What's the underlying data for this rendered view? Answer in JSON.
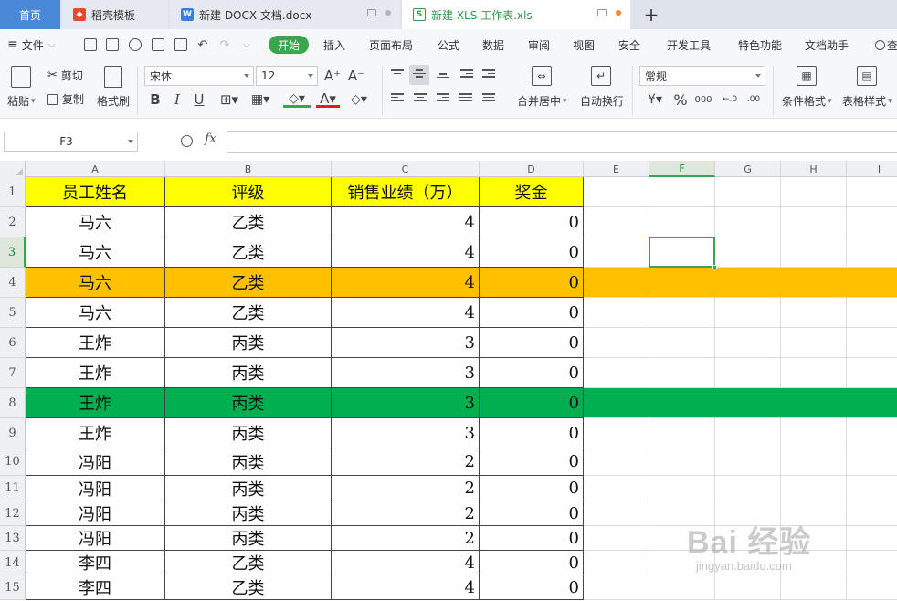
{
  "tabs": {
    "home": "首页",
    "templates": "稻壳模板",
    "docx": "新建 DOCX 文档.docx",
    "xls": "新建 XLS 工作表.xls",
    "add": "+"
  },
  "menu": {
    "file": "文件",
    "start": "开始",
    "items": [
      "插入",
      "页面布局",
      "公式",
      "数据",
      "审阅",
      "视图",
      "安全",
      "开发工具",
      "特色功能",
      "文档助手",
      "查"
    ]
  },
  "ribbon": {
    "paste": "粘贴",
    "cut": "剪切",
    "copy": "复制",
    "format_painter": "格式刷",
    "font_name": "宋体",
    "font_size": "12",
    "merge_center": "合并居中",
    "wrap_text": "自动换行",
    "number_format": "常规",
    "conditional_format": "条件格式",
    "table_style": "表格样式"
  },
  "formula_bar": {
    "name_box": "F3",
    "fx": "fx",
    "formula": ""
  },
  "columns": [
    "A",
    "B",
    "C",
    "D",
    "E",
    "F",
    "G",
    "H",
    "I"
  ],
  "active_column": "F",
  "active_row": "3",
  "rows": [
    {
      "num": "1",
      "fill": "yellow",
      "cells": [
        "员工姓名",
        "评级",
        "销售业绩（万）",
        "奖金"
      ]
    },
    {
      "num": "2",
      "fill": "none",
      "cells": [
        "马六",
        "乙类",
        "4",
        "0"
      ]
    },
    {
      "num": "3",
      "fill": "none",
      "cells": [
        "马六",
        "乙类",
        "4",
        "0"
      ]
    },
    {
      "num": "4",
      "fill": "orange",
      "cells": [
        "马六",
        "乙类",
        "4",
        "0"
      ]
    },
    {
      "num": "5",
      "fill": "none",
      "cells": [
        "马六",
        "乙类",
        "4",
        "0"
      ]
    },
    {
      "num": "6",
      "fill": "none",
      "cells": [
        "王炸",
        "丙类",
        "3",
        "0"
      ]
    },
    {
      "num": "7",
      "fill": "none",
      "cells": [
        "王炸",
        "丙类",
        "3",
        "0"
      ]
    },
    {
      "num": "8",
      "fill": "green",
      "cells": [
        "王炸",
        "丙类",
        "3",
        "0"
      ]
    },
    {
      "num": "9",
      "fill": "none",
      "cells": [
        "王炸",
        "丙类",
        "3",
        "0"
      ]
    },
    {
      "num": "10",
      "fill": "none",
      "cells": [
        "冯阳",
        "丙类",
        "2",
        "0"
      ]
    },
    {
      "num": "11",
      "fill": "none",
      "cells": [
        "冯阳",
        "丙类",
        "2",
        "0"
      ]
    },
    {
      "num": "12",
      "fill": "none",
      "cells": [
        "冯阳",
        "丙类",
        "2",
        "0"
      ]
    },
    {
      "num": "13",
      "fill": "none",
      "cells": [
        "冯阳",
        "丙类",
        "2",
        "0"
      ]
    },
    {
      "num": "14",
      "fill": "none",
      "cells": [
        "李四",
        "乙类",
        "4",
        "0"
      ]
    },
    {
      "num": "15",
      "fill": "none",
      "cells": [
        "李四",
        "乙类",
        "4",
        "0"
      ]
    }
  ],
  "fill_colors": {
    "yellow": "#ffff00",
    "orange": "#ffc000",
    "green": "#00b050",
    "none": "#ffffff"
  },
  "watermark": {
    "text": "Bai 经验",
    "url": "jingyan.baidu.com"
  }
}
